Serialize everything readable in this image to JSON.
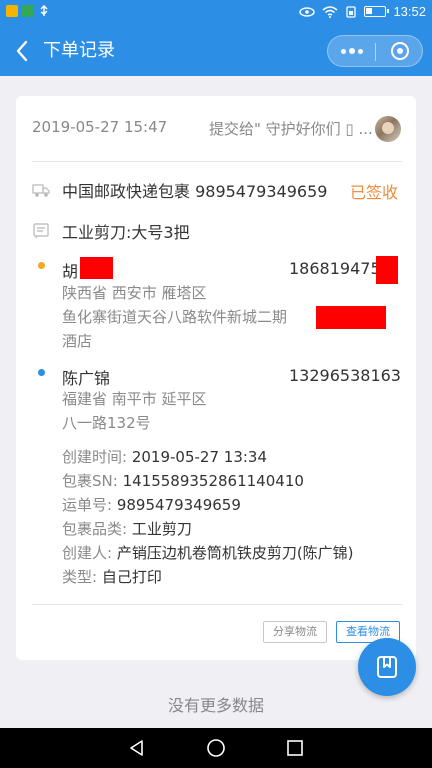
{
  "status_bar": {
    "time": "13:52",
    "battery_level": 0.35,
    "app_icon_colors": [
      "#f4b400",
      "#34a853",
      "#ea4335"
    ]
  },
  "navbar": {
    "title": "下单记录",
    "more_icon": "more-dots-icon",
    "close_icon": "record-circle-icon"
  },
  "order": {
    "created_at": "2019-05-27 15:47",
    "submitted_to": "提交给\" 守护好你们 ▯ ...",
    "carrier_line": "中国邮政快递包裹 9895479349659",
    "status": "已签收",
    "item_line": "工业剪刀:大号3把",
    "sender": {
      "name": "胡",
      "phone": "186819475",
      "region": "陕西省 西安市 雁塔区",
      "address_line1": "鱼化寨街道天谷八路软件新城二期",
      "address_line2": "酒店",
      "dot_color": "#f5a623"
    },
    "receiver": {
      "name": "陈广锦",
      "phone": "13296538163",
      "region": "福建省 南平市 延平区",
      "address": "八一路132号",
      "dot_color": "#2d8ee6"
    },
    "details": [
      {
        "label": "创建时间: ",
        "value": "2019-05-27 13:34"
      },
      {
        "label": "包裹SN: ",
        "value": "1415589352861140410"
      },
      {
        "label": "运单号: ",
        "value": "9895479349659"
      },
      {
        "label": "包裹品类: ",
        "value": "工业剪刀"
      },
      {
        "label": "创建人: ",
        "value": "产销压边机卷筒机铁皮剪刀(陈广锦)"
      },
      {
        "label": "类型: ",
        "value": "自己打印"
      }
    ],
    "share_button": "分享物流",
    "view_button": "查看物流"
  },
  "footer": {
    "no_more": "没有更多数据"
  },
  "colors": {
    "primary": "#2d8ee6",
    "status_orange": "#f08c3c",
    "redaction": "#ff0000"
  }
}
